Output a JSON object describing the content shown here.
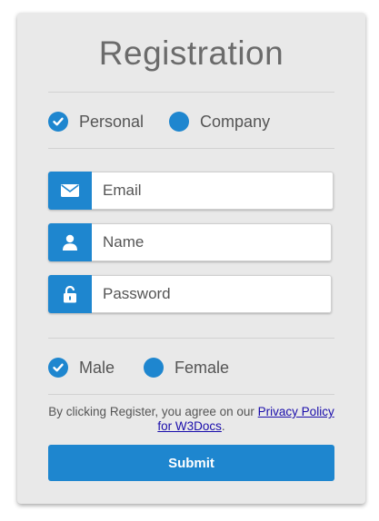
{
  "form": {
    "title": "Registration",
    "account_type": {
      "options": [
        {
          "label": "Personal",
          "checked": true
        },
        {
          "label": "Company",
          "checked": false
        }
      ]
    },
    "fields": {
      "email": {
        "placeholder": "Email",
        "icon": "envelope-icon"
      },
      "name": {
        "placeholder": "Name",
        "icon": "user-icon"
      },
      "password": {
        "placeholder": "Password",
        "icon": "unlock-icon"
      }
    },
    "gender": {
      "options": [
        {
          "label": "Male",
          "checked": true
        },
        {
          "label": "Female",
          "checked": false
        }
      ]
    },
    "terms": {
      "prefix": "By clicking Register, you agree on our ",
      "link_text": "Privacy Policy for W3Docs",
      "suffix": "."
    },
    "submit_label": "Submit"
  },
  "colors": {
    "accent": "#1e86cf",
    "card_background": "#e9e9e9",
    "link": "#1a0dab"
  }
}
